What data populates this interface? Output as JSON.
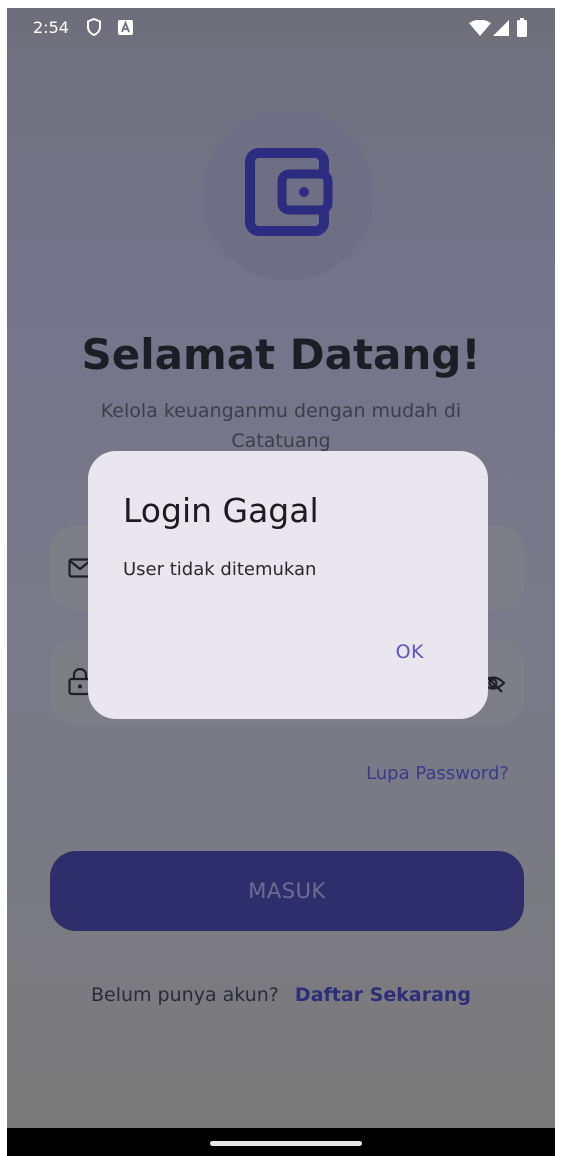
{
  "status_bar": {
    "time": "2:54",
    "icons": [
      "shield-icon",
      "notification-a-icon",
      "wifi-icon",
      "signal-icon",
      "battery-icon"
    ]
  },
  "login": {
    "logo_icon": "wallet-icon",
    "title": "Selamat Datang!",
    "subtitle": "Kelola keuanganmu dengan mudah di Catatuang",
    "email_icon": "mail-icon",
    "password_icon": "lock-icon",
    "visibility_icon": "eye-off-icon",
    "forgot_password": "Lupa Password?",
    "submit_label": "MASUK",
    "register_prompt": "Belum punya akun?",
    "register_link": "Daftar Sekarang"
  },
  "dialog": {
    "title": "Login Gagal",
    "message": "User tidak ditemukan",
    "ok_label": "OK"
  },
  "colors": {
    "primary": "#2e2e6d",
    "dialog_bg": "#e9e6ee",
    "dialog_button": "#5b52c8",
    "link": "#3a3a8c"
  }
}
